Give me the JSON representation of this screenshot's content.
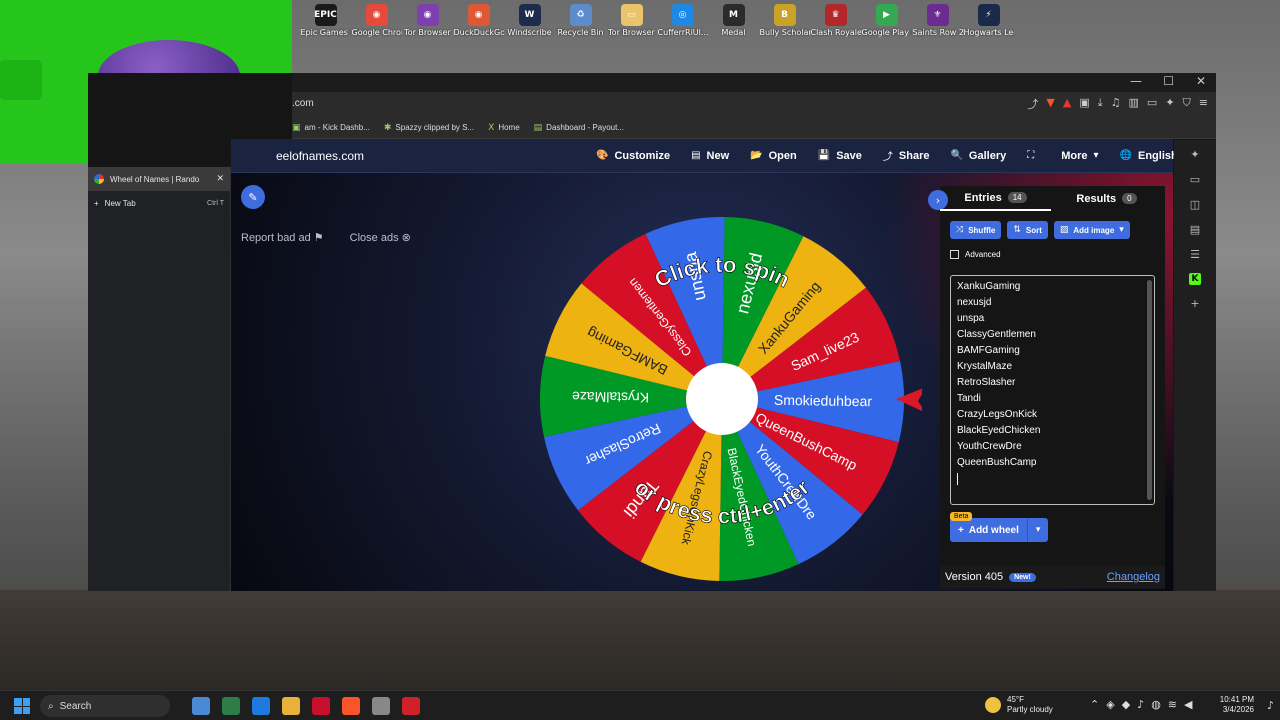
{
  "desktop": {
    "icons": [
      {
        "label": "Epic Games Launcher",
        "color": "#1a1a1a",
        "glyph": "EPIC"
      },
      {
        "label": "Google Chrome",
        "color": "#e64a3a",
        "glyph": "◉"
      },
      {
        "label": "Tor Browser",
        "color": "#7e3fb0",
        "glyph": "◉"
      },
      {
        "label": "DuckDuckGo",
        "color": "#de5833",
        "glyph": "◉"
      },
      {
        "label": "Windscribe",
        "color": "#1d2b4c",
        "glyph": "W"
      },
      {
        "label": "Recycle Bin",
        "color": "#5c8cc9",
        "glyph": "♻"
      },
      {
        "label": "Tor Browser",
        "color": "#e9c46a",
        "glyph": "▭"
      },
      {
        "label": "CufferrRiUl...",
        "color": "#1e88e5",
        "glyph": "◎"
      },
      {
        "label": "Medal",
        "color": "#2b2b2b",
        "glyph": "M"
      },
      {
        "label": "Bully Scholarsh...",
        "color": "#c9a227",
        "glyph": "B"
      },
      {
        "label": "Clash Royale",
        "color": "#b3262a",
        "glyph": "♛"
      },
      {
        "label": "Google Play Games",
        "color": "#34a853",
        "glyph": "▶"
      },
      {
        "label": "Saints Row 2",
        "color": "#6a2c91",
        "glyph": "⚜"
      },
      {
        "label": "Hogwarts Legacy",
        "color": "#1a2a4a",
        "glyph": "⚡"
      }
    ]
  },
  "browser": {
    "url": ".com",
    "window_controls": {
      "minimize": "—",
      "maximize": "☐",
      "close": "✕"
    },
    "bookmarks": [
      {
        "label": "am - Kick Dashb...",
        "icon": "▣"
      },
      {
        "label": "Spazzy clipped by S...",
        "icon": "✱"
      },
      {
        "label": "Home",
        "icon": "X"
      },
      {
        "label": "Dashboard - Payout...",
        "icon": "▤"
      }
    ],
    "tabs": [
      {
        "title": "Wheel of Names | Rando",
        "close": "✕"
      },
      {
        "title": "New Tab",
        "shortcut": "Ctrl  T",
        "icon": "+"
      }
    ]
  },
  "site": {
    "name": "eelofnames.com",
    "menu": [
      {
        "label": "Customize",
        "icon": "🎨"
      },
      {
        "label": "New",
        "icon": "▤"
      },
      {
        "label": "Open",
        "icon": "📂"
      },
      {
        "label": "Save",
        "icon": "💾"
      },
      {
        "label": "Share",
        "icon": "⤴"
      },
      {
        "label": "Gallery",
        "icon": "🔍"
      },
      {
        "label": "",
        "icon": "⛶"
      },
      {
        "label": "More",
        "icon": "▾"
      },
      {
        "label": "English",
        "icon": "🌐"
      }
    ],
    "report_bad_ad": "Report bad ad",
    "close_ads": "Close ads",
    "wheel": {
      "top_text": "Click to spin",
      "bottom_text": "or press ctrl+enter",
      "segments": [
        {
          "name": "unspa",
          "color": "#3369e8"
        },
        {
          "name": "nexusjd",
          "color": "#009925"
        },
        {
          "name": "XankuGaming",
          "color": "#eeb211"
        },
        {
          "name": "Sam_live23",
          "color": "#d50f25"
        },
        {
          "name": "Smokieduhbear",
          "color": "#3369e8"
        },
        {
          "name": "QueenBushCamp",
          "color": "#d50f25"
        },
        {
          "name": "YouthCrewDre",
          "color": "#3369e8"
        },
        {
          "name": "BlackEyedChicken",
          "color": "#009925"
        },
        {
          "name": "CrazyLegsOnKick",
          "color": "#eeb211"
        },
        {
          "name": "Tandi",
          "color": "#d50f25"
        },
        {
          "name": "RetroSlasher",
          "color": "#3369e8"
        },
        {
          "name": "KrystalMaze",
          "color": "#009925"
        },
        {
          "name": "BAMFGaming",
          "color": "#eeb211"
        },
        {
          "name": "ClassyGentlemen",
          "color": "#d50f25"
        }
      ]
    }
  },
  "panel": {
    "entries_tab": "Entries",
    "entries_count": "14",
    "results_tab": "Results",
    "results_count": "0",
    "buttons": {
      "shuffle": "Shuffle",
      "sort": "Sort",
      "add_image": "Add image"
    },
    "advanced": "Advanced",
    "entries": [
      "XankuGaming",
      "nexusjd",
      "unspa",
      "ClassyGentlemen",
      "BAMFGaming",
      "KrystalMaze",
      "RetroSlasher",
      "Tandi",
      "CrazyLegsOnKick",
      "BlackEyedChicken",
      "YouthCrewDre",
      "QueenBushCamp"
    ],
    "beta": "Beta",
    "add_wheel": "Add wheel",
    "version": "Version 405",
    "new_badge": "New!",
    "changelog": "Changelog"
  },
  "taskbar": {
    "search": "Search",
    "weather_temp": "45°F",
    "weather_desc": "Partly cloudy",
    "time": "10:41 PM",
    "date": "3/4/2026",
    "apps": [
      "#4a8ad4",
      "#2d7d46",
      "#1f7ae0",
      "#e8b23a",
      "#c8102e",
      "#fb542b",
      "#888888",
      "#d0202a"
    ]
  }
}
